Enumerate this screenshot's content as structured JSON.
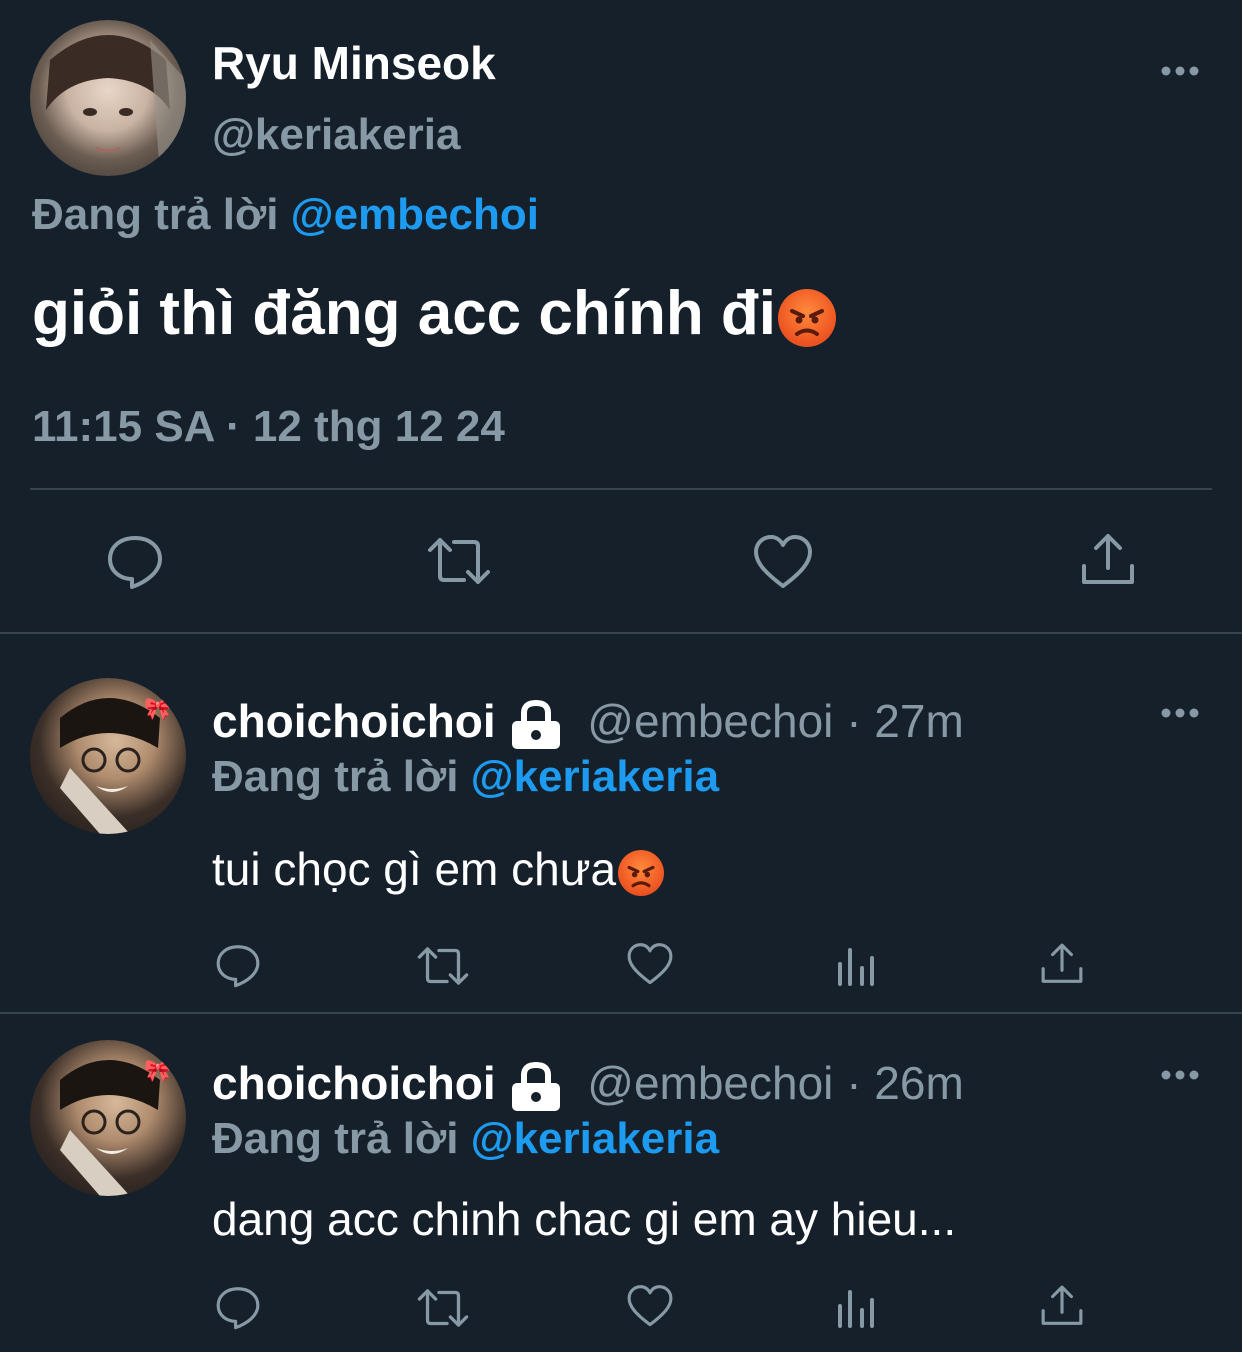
{
  "main_tweet": {
    "display_name": "Ryu Minseok",
    "handle": "@keriakeria",
    "replying_prefix": "Đang trả lời",
    "replying_to": "@embechoi",
    "text": "giỏi thì đăng acc chính đi",
    "emoji": "angry-face-icon",
    "timestamp": "11:15 SA · 12 thg 12 24"
  },
  "replies": [
    {
      "display_name": "choichoichoi",
      "handle": "@embechoi",
      "time": "· 27m",
      "replying_prefix": "Đang trả lời",
      "replying_to": "@keriakeria",
      "text": "tui chọc gì em chưa"
    },
    {
      "display_name": "choichoichoi",
      "handle": "@embechoi",
      "time": "· 26m",
      "replying_prefix": "Đang trả lời",
      "replying_to": "@keriakeria",
      "text": "dang acc chinh chac gi em ay hieu..."
    }
  ],
  "colors": {
    "background": "#15202b",
    "secondary_text": "#8899a6",
    "link": "#1d9bf0",
    "divider": "#38444d"
  }
}
